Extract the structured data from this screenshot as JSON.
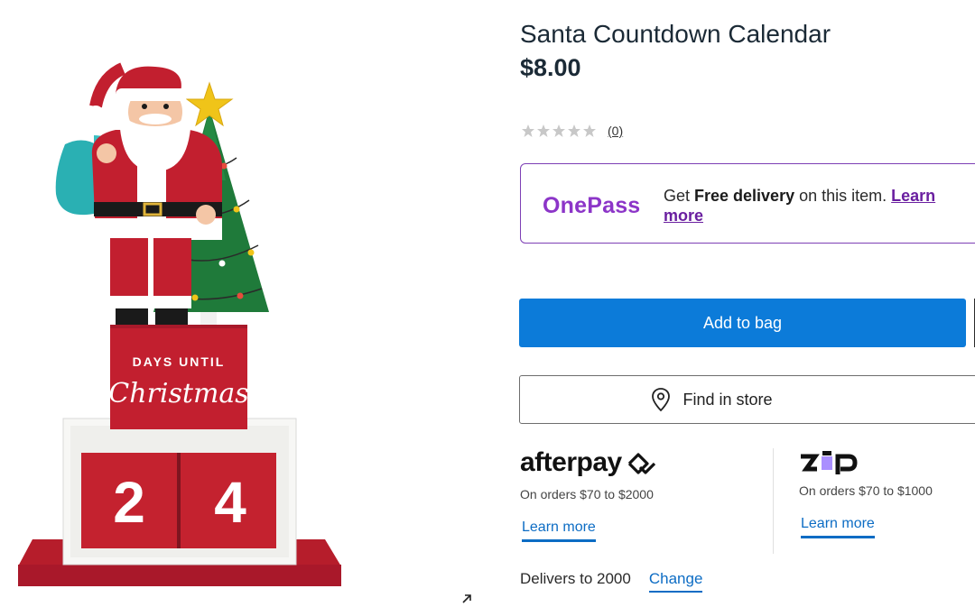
{
  "product": {
    "title": "Santa Countdown Calendar",
    "price": "$8.00",
    "rating": {
      "value": 0,
      "max": 5,
      "count_label": "(0)"
    },
    "image": {
      "sign_top": "DAYS UNTIL",
      "sign_script": "Christmas",
      "digit_1": "2",
      "digit_2": "4"
    }
  },
  "onepass": {
    "logo": "OnePass",
    "prefix": "Get ",
    "bold": "Free delivery",
    "suffix": " on this item. ",
    "link": "Learn more"
  },
  "actions": {
    "add_to_bag": "Add to bag",
    "find_in_store": "Find in store"
  },
  "afterpay": {
    "logo": "afterpay",
    "orders": "On orders $70 to $2000",
    "link": "Learn more"
  },
  "zip": {
    "logo": "zip",
    "orders": "On orders $70 to $1000",
    "link": "Learn more"
  },
  "delivery": {
    "text": "Delivers to 2000",
    "link": "Change"
  },
  "colors": {
    "primary_button": "#0c7bd9",
    "onepass_purple": "#8c35c8",
    "link_blue": "#0c6cc4",
    "santa_red": "#c21f2f"
  },
  "icons": [
    "star-icon",
    "map-pin-icon",
    "afterpay-arrows-icon",
    "expand-icon"
  ]
}
